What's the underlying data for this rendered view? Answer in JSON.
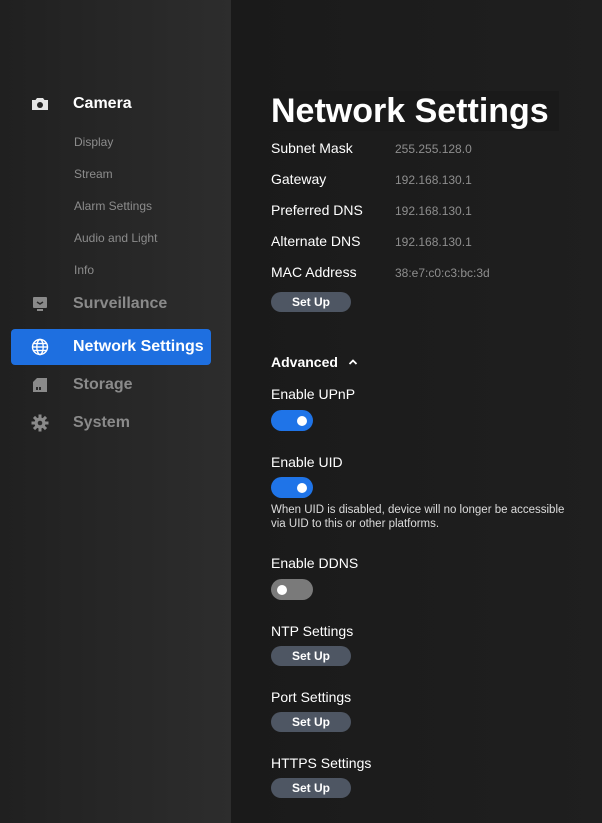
{
  "sidebar": {
    "camera": {
      "label": "Camera",
      "icon": "camera-icon"
    },
    "camera_subitems": [
      "Display",
      "Stream",
      "Alarm Settings",
      "Audio and Light",
      "Info"
    ],
    "surveillance": {
      "label": "Surveillance",
      "icon": "monitor-icon"
    },
    "network": {
      "label": "Network Settings",
      "icon": "globe-icon"
    },
    "storage": {
      "label": "Storage",
      "icon": "sd-card-icon"
    },
    "system": {
      "label": "System",
      "icon": "gear-icon"
    }
  },
  "main": {
    "title": "Network Settings",
    "network_rows": [
      {
        "label": "Subnet Mask",
        "value": "255.255.128.0"
      },
      {
        "label": "Gateway",
        "value": "192.168.130.1"
      },
      {
        "label": "Preferred DNS",
        "value": "192.168.130.1"
      },
      {
        "label": "Alternate DNS",
        "value": "192.168.130.1"
      },
      {
        "label": "MAC Address",
        "value": "38:e7:c0:c3:bc:3d"
      }
    ],
    "setup_label": "Set Up",
    "advanced": {
      "heading": "Advanced",
      "upnp": {
        "label": "Enable UPnP",
        "enabled": true
      },
      "uid": {
        "label": "Enable UID",
        "enabled": true,
        "note": "When UID is disabled, device will no longer be accessible via UID to this or other platforms."
      },
      "ddns": {
        "label": "Enable DDNS",
        "enabled": false
      },
      "ntp": {
        "label": "NTP Settings",
        "button": "Set Up"
      },
      "port": {
        "label": "Port Settings",
        "button": "Set Up"
      },
      "https": {
        "label": "HTTPS Settings",
        "button": "Set Up"
      }
    }
  },
  "colors": {
    "accent": "#1e6fe0",
    "toggle_on": "#1f74e8",
    "toggle_off": "#7a7a7a",
    "button_bg": "#4e5663",
    "sidebar_bg": "#2a2a2a",
    "main_bg": "#1c1c1c"
  }
}
